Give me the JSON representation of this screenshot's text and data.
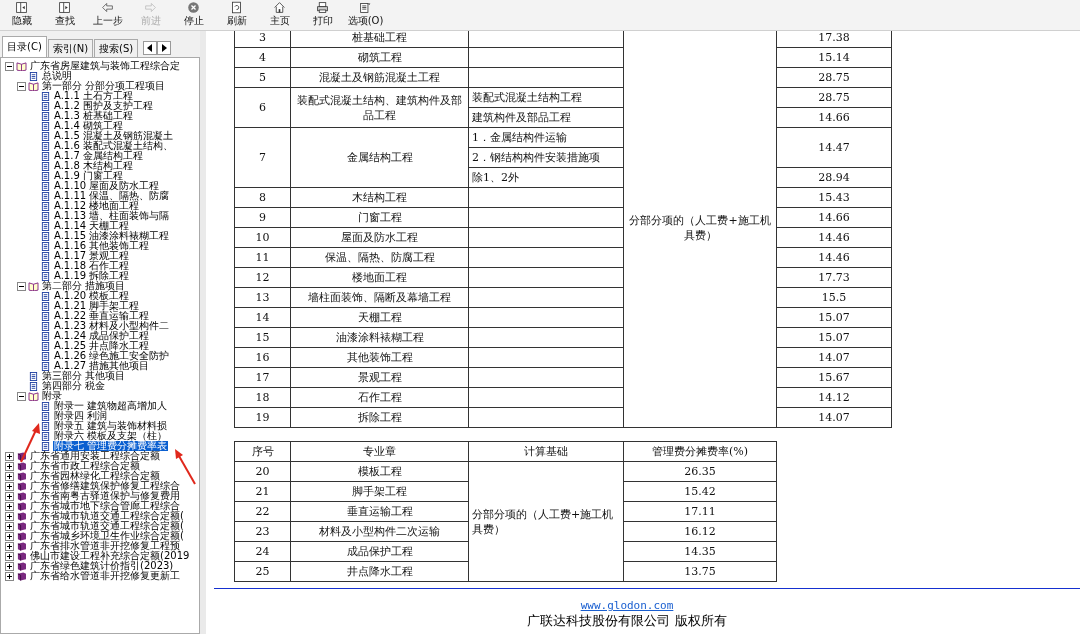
{
  "toolbar": [
    {
      "label": "隐藏",
      "kind": "hide",
      "disabled": false
    },
    {
      "label": "查找",
      "kind": "find",
      "disabled": false
    },
    {
      "label": "上一步",
      "kind": "back",
      "disabled": false
    },
    {
      "label": "前进",
      "kind": "forward",
      "disabled": true
    },
    {
      "label": "停止",
      "kind": "stop",
      "disabled": false
    },
    {
      "label": "刷新",
      "kind": "refresh",
      "disabled": false
    },
    {
      "label": "主页",
      "kind": "home",
      "disabled": false
    },
    {
      "label": "打印",
      "kind": "print",
      "disabled": false
    },
    {
      "label": "选项(O)",
      "kind": "options",
      "disabled": false
    }
  ],
  "sidebar": {
    "tabs": [
      {
        "label": "目录(C)",
        "selected": true
      },
      {
        "label": "索引(N)",
        "selected": false
      },
      {
        "label": "搜索(S)",
        "selected": false
      }
    ],
    "tree": [
      {
        "label": "广东省房屋建筑与装饰工程综合定",
        "kind": "book",
        "expanded": true,
        "selected": false,
        "children": [
          {
            "label": "总说明",
            "kind": "page",
            "selected": false
          },
          {
            "label": "第一部分 分部分项工程项目",
            "kind": "book",
            "expanded": true,
            "selected": false,
            "children": [
              {
                "label": "A.1.1 土石方工程",
                "kind": "page",
                "selected": false
              },
              {
                "label": "A.1.2 围护及支护工程",
                "kind": "page",
                "selected": false
              },
              {
                "label": "A.1.3 桩基础工程",
                "kind": "page",
                "selected": false
              },
              {
                "label": "A.1.4 砌筑工程",
                "kind": "page",
                "selected": false
              },
              {
                "label": "A.1.5 混凝土及钢筋混凝土",
                "kind": "page",
                "selected": false
              },
              {
                "label": "A.1.6 装配式混凝土结构、",
                "kind": "page",
                "selected": false
              },
              {
                "label": "A.1.7 金属结构工程",
                "kind": "page",
                "selected": false
              },
              {
                "label": "A.1.8 木结构工程",
                "kind": "page",
                "selected": false
              },
              {
                "label": "A.1.9 门窗工程",
                "kind": "page",
                "selected": false
              },
              {
                "label": "A.1.10 屋面及防水工程",
                "kind": "page",
                "selected": false
              },
              {
                "label": "A.1.11 保温、隔热、防腐",
                "kind": "page",
                "selected": false
              },
              {
                "label": "A.1.12 楼地面工程",
                "kind": "page",
                "selected": false
              },
              {
                "label": "A.1.13 墙、柱面装饰与隔",
                "kind": "page",
                "selected": false
              },
              {
                "label": "A.1.14 天棚工程",
                "kind": "page",
                "selected": false
              },
              {
                "label": "A.1.15 油漆涂料裱糊工程",
                "kind": "page",
                "selected": false
              },
              {
                "label": "A.1.16 其他装饰工程",
                "kind": "page",
                "selected": false
              },
              {
                "label": "A.1.17 景观工程",
                "kind": "page",
                "selected": false
              },
              {
                "label": "A.1.18 石作工程",
                "kind": "page",
                "selected": false
              },
              {
                "label": "A.1.19 拆除工程",
                "kind": "page",
                "selected": false
              }
            ]
          },
          {
            "label": "第二部分 措施项目",
            "kind": "book",
            "expanded": true,
            "selected": false,
            "children": [
              {
                "label": "A.1.20 模板工程",
                "kind": "page",
                "selected": false
              },
              {
                "label": "A.1.21 脚手架工程",
                "kind": "page",
                "selected": false
              },
              {
                "label": "A.1.22 垂直运输工程",
                "kind": "page",
                "selected": false
              },
              {
                "label": "A.1.23 材料及小型构件二",
                "kind": "page",
                "selected": false
              },
              {
                "label": "A.1.24 成品保护工程",
                "kind": "page",
                "selected": false
              },
              {
                "label": "A.1.25 井点降水工程",
                "kind": "page",
                "selected": false
              },
              {
                "label": "A.1.26 绿色施工安全防护",
                "kind": "page",
                "selected": false
              },
              {
                "label": "A.1.27 措施其他项目",
                "kind": "page",
                "selected": false
              }
            ]
          },
          {
            "label": "第三部分 其他项目",
            "kind": "page",
            "selected": false
          },
          {
            "label": "第四部分 税金",
            "kind": "page",
            "selected": false
          },
          {
            "label": "附录",
            "kind": "book",
            "expanded": true,
            "selected": false,
            "children": [
              {
                "label": "附录一 建筑物超高增加人",
                "kind": "page",
                "selected": false
              },
              {
                "label": "附录四 利润",
                "kind": "page",
                "selected": false
              },
              {
                "label": "附录五 建筑与装饰材料损",
                "kind": "page",
                "selected": false
              },
              {
                "label": "附录六 模板及支架（柱）",
                "kind": "page",
                "selected": false
              },
              {
                "label": "附录七 管理费分摊费率表",
                "kind": "page",
                "selected": true
              }
            ]
          }
        ]
      },
      {
        "label": "广东省通用安装工程综合定额",
        "kind": "book",
        "expanded": false,
        "selected": false
      },
      {
        "label": "广东省市政工程综合定额",
        "kind": "book",
        "expanded": false,
        "selected": false
      },
      {
        "label": "广东省园林绿化工程综合定额",
        "kind": "book",
        "expanded": false,
        "selected": false
      },
      {
        "label": "广东省修缮建筑保护修复工程综合",
        "kind": "book",
        "expanded": false,
        "selected": false
      },
      {
        "label": "广东省南粤古驿道保护与修复费用",
        "kind": "book",
        "expanded": false,
        "selected": false
      },
      {
        "label": "广东省城市地下综合管廊工程综合",
        "kind": "book",
        "expanded": false,
        "selected": false
      },
      {
        "label": "广东省城市轨道交通工程综合定额(",
        "kind": "book",
        "expanded": false,
        "selected": false
      },
      {
        "label": "广东省城市轨道交通工程综合定额(",
        "kind": "book",
        "expanded": false,
        "selected": false
      },
      {
        "label": "广东省城乡环境卫生作业综合定额(",
        "kind": "book",
        "expanded": false,
        "selected": false
      },
      {
        "label": "广东省排水管道非开挖修复工程预",
        "kind": "book",
        "expanded": false,
        "selected": false
      },
      {
        "label": "佛山市建设工程补充综合定额(2019",
        "kind": "book",
        "expanded": false,
        "selected": false
      },
      {
        "label": "广东省绿色建筑计价指引(2023)",
        "kind": "book",
        "expanded": false,
        "selected": false
      },
      {
        "label": "广东省给水管道非开挖修复更新工",
        "kind": "book",
        "expanded": false,
        "selected": false
      }
    ]
  },
  "table_1": {
    "basis": "分部分项的（人工费+施工机具费）",
    "rows": [
      {
        "no": "3",
        "name": "桩基础工程",
        "subs": [],
        "rates": [
          {
            "value": "17.38"
          }
        ]
      },
      {
        "no": "4",
        "name": "砌筑工程",
        "subs": [],
        "rates": [
          {
            "value": "15.14"
          }
        ]
      },
      {
        "no": "5",
        "name": "混凝土及钢筋混凝土工程",
        "subs": [],
        "rates": [
          {
            "value": "28.75"
          }
        ]
      },
      {
        "no": "6",
        "name": "装配式混凝土结构、建筑构件及部品工程",
        "subs": [
          {
            "text": "装配式混凝土结构工程"
          },
          {
            "text": "建筑构件及部品工程"
          }
        ],
        "rates": [
          {
            "value": "28.75"
          },
          {
            "value": "14.66"
          }
        ]
      },
      {
        "no": "7",
        "name": "金属结构工程",
        "subs": [
          {
            "text": "1．金属结构件运输"
          },
          {
            "text": "2．钢结构构件安装措施项"
          },
          {
            "text": "除1、2外"
          }
        ],
        "rates": [
          {
            "value": "14.47",
            "rowspan": 2
          },
          {
            "value": "28.94"
          }
        ]
      },
      {
        "no": "8",
        "name": "木结构工程",
        "subs": [],
        "rates": [
          {
            "value": "15.43"
          }
        ]
      },
      {
        "no": "9",
        "name": "门窗工程",
        "subs": [],
        "rates": [
          {
            "value": "14.66"
          }
        ]
      },
      {
        "no": "10",
        "name": "屋面及防水工程",
        "subs": [],
        "rates": [
          {
            "value": "14.46"
          }
        ]
      },
      {
        "no": "11",
        "name": "保温、隔热、防腐工程",
        "subs": [],
        "rates": [
          {
            "value": "14.46"
          }
        ]
      },
      {
        "no": "12",
        "name": "楼地面工程",
        "subs": [],
        "rates": [
          {
            "value": "17.73"
          }
        ]
      },
      {
        "no": "13",
        "name": "墙柱面装饰、隔断及幕墙工程",
        "subs": [],
        "rates": [
          {
            "value": "15.5"
          }
        ]
      },
      {
        "no": "14",
        "name": "天棚工程",
        "subs": [],
        "rates": [
          {
            "value": "15.07"
          }
        ]
      },
      {
        "no": "15",
        "name": "油漆涂料裱糊工程",
        "subs": [],
        "rates": [
          {
            "value": "15.07"
          }
        ]
      },
      {
        "no": "16",
        "name": "其他装饰工程",
        "subs": [],
        "rates": [
          {
            "value": "14.07"
          }
        ]
      },
      {
        "no": "17",
        "name": "景观工程",
        "subs": [],
        "rates": [
          {
            "value": "15.67"
          }
        ]
      },
      {
        "no": "18",
        "name": "石作工程",
        "subs": [],
        "rates": [
          {
            "value": "14.12"
          }
        ]
      },
      {
        "no": "19",
        "name": "拆除工程",
        "subs": [],
        "rates": [
          {
            "value": "14.07"
          }
        ]
      }
    ]
  },
  "table_2": {
    "columns": [
      "序号",
      "专业章",
      "计算基础",
      "管理费分摊费率(%)"
    ],
    "basis": "分部分项的（人工费+施工机具费）",
    "rows": [
      {
        "no": "20",
        "name": "模板工程",
        "rate": "26.35"
      },
      {
        "no": "21",
        "name": "脚手架工程",
        "rate": "15.42"
      },
      {
        "no": "22",
        "name": "垂直运输工程",
        "rate": "17.11"
      },
      {
        "no": "23",
        "name": "材料及小型构件二次运输",
        "rate": "16.12"
      },
      {
        "no": "24",
        "name": "成品保护工程",
        "rate": "14.35"
      },
      {
        "no": "25",
        "name": "井点降水工程",
        "rate": "13.75"
      }
    ]
  },
  "footer": {
    "link": "www.glodon.com",
    "copyright": "广联达科技股份有限公司 版权所有"
  }
}
